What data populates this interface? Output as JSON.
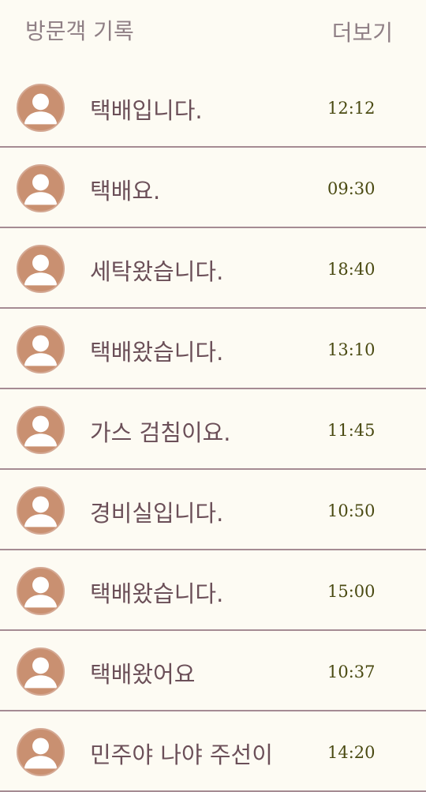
{
  "header": {
    "title": "방문객 기록",
    "more_label": "더보기"
  },
  "visitor_log": [
    {
      "message": "택배입니다.",
      "time": "12:12",
      "icon": "user-avatar-icon"
    },
    {
      "message": "택배요.",
      "time": "09:30",
      "icon": "user-avatar-icon"
    },
    {
      "message": "세탁왔습니다.",
      "time": "18:40",
      "icon": "user-avatar-icon"
    },
    {
      "message": "택배왔습니다.",
      "time": "13:10",
      "icon": "user-avatar-icon"
    },
    {
      "message": "가스 검침이요.",
      "time": "11:45",
      "icon": "user-avatar-icon"
    },
    {
      "message": "경비실입니다.",
      "time": "10:50",
      "icon": "user-avatar-icon"
    },
    {
      "message": "택배왔습니다.",
      "time": "15:00",
      "icon": "user-avatar-icon"
    },
    {
      "message": "택배왔어요",
      "time": "10:37",
      "icon": "user-avatar-icon"
    },
    {
      "message": "민주야 나야 주선이",
      "time": "14:20",
      "icon": "user-avatar-icon"
    }
  ],
  "colors": {
    "background": "#fdfbf3",
    "divider": "#a58b93",
    "avatar": "#c99071",
    "message_text": "#6b4f58",
    "time_text": "#4a4a12",
    "header_text": "#8f7f85"
  }
}
